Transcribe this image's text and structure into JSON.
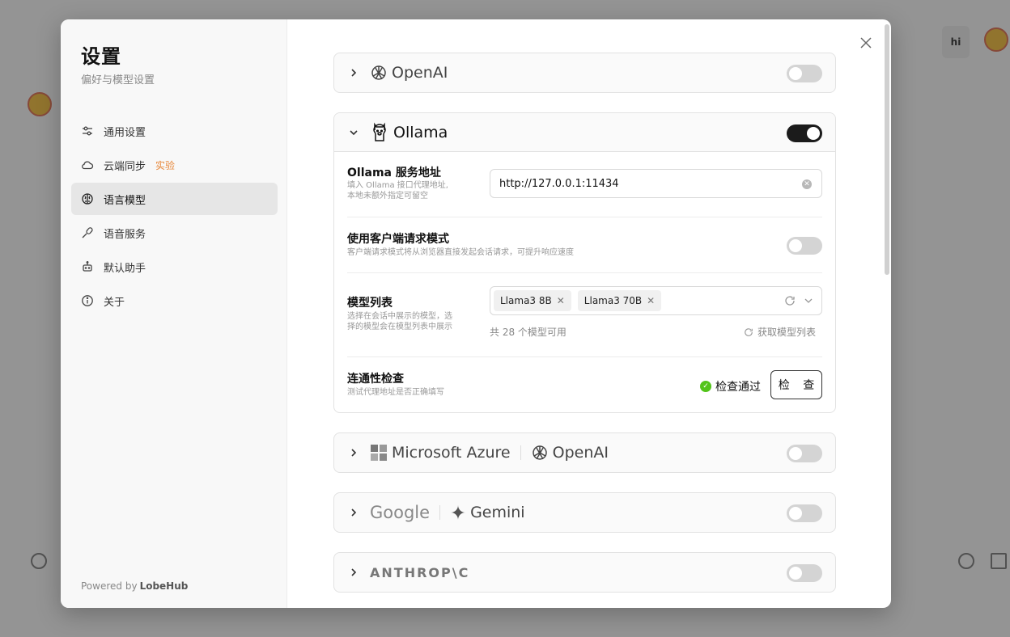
{
  "background": {
    "hi_label": "hi"
  },
  "sidebar": {
    "title": "设置",
    "subtitle": "偏好与模型设置",
    "items": [
      {
        "label": "通用设置",
        "icon": "sliders-icon"
      },
      {
        "label": "云端同步",
        "icon": "cloud-icon",
        "badge": "实验"
      },
      {
        "label": "语言模型",
        "icon": "brain-icon",
        "active": true
      },
      {
        "label": "语音服务",
        "icon": "mic-icon"
      },
      {
        "label": "默认助手",
        "icon": "bot-icon"
      },
      {
        "label": "关于",
        "icon": "info-icon"
      }
    ],
    "powered_by": "Powered by",
    "brand": "LobeHub"
  },
  "providers": {
    "openai": {
      "name": "OpenAI",
      "enabled": false
    },
    "ollama": {
      "name": "Ollama",
      "enabled": true,
      "endpoint": {
        "label": "Ollama 服务地址",
        "desc_line1": "填入 Ollama 接口代理地址,",
        "desc_line2": "本地未额外指定可留空",
        "value": "http://127.0.0.1:11434"
      },
      "client_mode": {
        "label": "使用客户端请求模式",
        "desc": "客户端请求模式将从浏览器直接发起会话请求，可提升响应速度",
        "enabled": false
      },
      "model_list": {
        "label": "模型列表",
        "desc_line1": "选择在会话中展示的模型，选",
        "desc_line2": "择的模型会在模型列表中展示",
        "tags": [
          "Llama3 8B",
          "Llama3 70B"
        ],
        "count_text": "共 28 个模型可用",
        "fetch_label": "获取模型列表"
      },
      "connectivity": {
        "label": "连通性检查",
        "desc": "测试代理地址是否正确填写",
        "status": "检查通过",
        "button": "检 查"
      }
    },
    "azure": {
      "name": "Microsoft Azure",
      "name2": "OpenAI",
      "enabled": false
    },
    "google": {
      "name": "Google",
      "name2": "Gemini",
      "enabled": false
    },
    "anthropic": {
      "name": "ANTHROP\\C",
      "enabled": false
    }
  },
  "colors": {
    "accent": "#1b1b1b",
    "success": "#52c41a",
    "badge": "#e8883a"
  }
}
